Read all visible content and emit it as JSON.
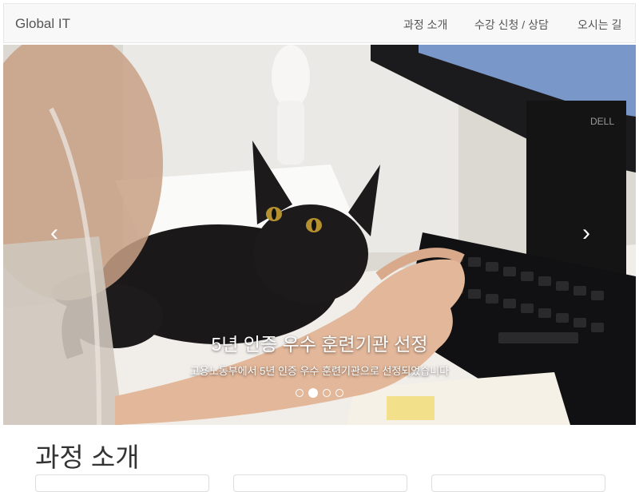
{
  "navbar": {
    "brand": "Global IT",
    "links": [
      {
        "label": "과정 소개"
      },
      {
        "label": "수강 신청 / 상담"
      },
      {
        "label": "오시는 길"
      }
    ]
  },
  "carousel": {
    "slide_title": "5년 인증 우수 훈련기관 선정",
    "slide_subtitle": "고용노동부에서 5년 인증 우수 훈련기관으로 선정되었습니다",
    "prev_icon": "‹",
    "next_icon": "›",
    "indicator_count": 4,
    "active_indicator": 2,
    "monitor_brand": "DELL"
  },
  "section": {
    "title": "과정 소개"
  },
  "colors": {
    "navbar_bg": "#f8f8f8",
    "text": "#555555",
    "heading": "#333333"
  }
}
